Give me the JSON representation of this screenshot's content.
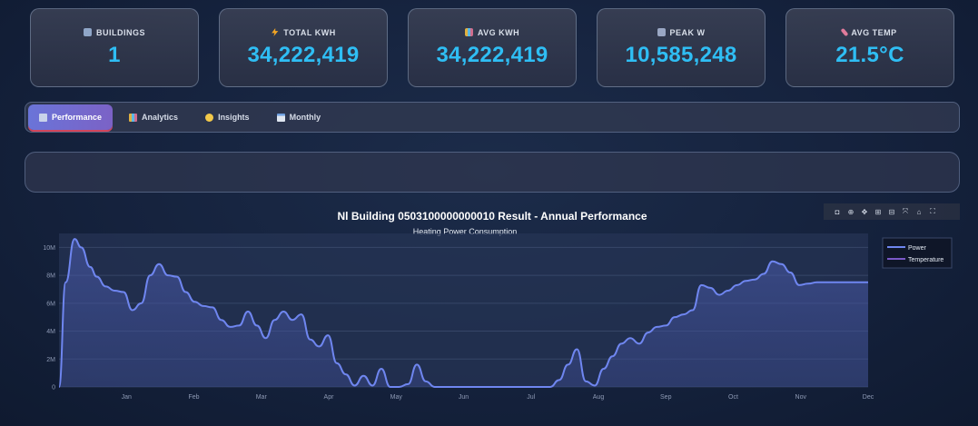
{
  "kpis": [
    {
      "label": "BUILDINGS",
      "value": "1",
      "icon": "building-icon",
      "icon_color": "#8fa6c8"
    },
    {
      "label": "TOTAL KWH",
      "value": "34,222,419",
      "icon": "lightning-icon",
      "icon_color": "#f5a623"
    },
    {
      "label": "AVG KWH",
      "value": "34,222,419",
      "icon": "bar-chart-icon",
      "icon_color": "#8c7fd4"
    },
    {
      "label": "PEAK W",
      "value": "10,585,248",
      "icon": "trend-chart-icon",
      "icon_color": "#9aa7c4"
    },
    {
      "label": "AVG TEMP",
      "value": "21.5°C",
      "icon": "thermometer-icon",
      "icon_color": "#e07b9b"
    }
  ],
  "tabs": [
    {
      "label": "Performance",
      "icon": "line-chart-icon",
      "active": true
    },
    {
      "label": "Analytics",
      "icon": "bar-chart-icon",
      "active": false
    },
    {
      "label": "Insights",
      "icon": "lightbulb-icon",
      "active": false
    },
    {
      "label": "Monthly",
      "icon": "calendar-icon",
      "active": false
    }
  ],
  "colors": {
    "accent": "#2fbef4",
    "series_power": "#6f86f0",
    "series_temperature": "#7a58c8"
  },
  "chart_data": {
    "type": "area",
    "title": "Nl Building 0503100000000010 Result - Annual Performance",
    "subtitle": "Heating Power Consumption",
    "xlabel": "",
    "ylabel": "",
    "x_tick_labels": [
      "Jan",
      "Feb",
      "Mar",
      "Apr",
      "May",
      "Jun",
      "Jul",
      "Aug",
      "Sep",
      "Oct",
      "Nov",
      "Dec"
    ],
    "y_tick_labels": [
      "0",
      "2M",
      "4M",
      "6M",
      "8M",
      "10M"
    ],
    "ylim": [
      0,
      11000000
    ],
    "x_unit": "day of year",
    "xlim": [
      1,
      365
    ],
    "grid": true,
    "legend": {
      "placement": "top-right",
      "entries": [
        "Power",
        "Temperature"
      ]
    },
    "series": [
      {
        "name": "Power",
        "x": [
          1,
          4,
          8,
          11,
          15,
          18,
          22,
          26,
          30,
          34,
          38,
          42,
          46,
          50,
          54,
          58,
          62,
          66,
          70,
          74,
          78,
          82,
          86,
          90,
          94,
          98,
          102,
          106,
          110,
          114,
          118,
          122,
          126,
          130,
          134,
          138,
          142,
          146,
          150,
          154,
          158,
          162,
          166,
          170,
          174,
          178,
          182,
          186,
          190,
          194,
          198,
          202,
          206,
          210,
          214,
          218,
          222,
          226,
          230,
          234,
          238,
          242,
          246,
          250,
          254,
          258,
          262,
          266,
          270,
          274,
          278,
          282,
          286,
          290,
          294,
          298,
          302,
          306,
          310,
          314,
          318,
          322,
          326,
          330,
          334,
          338,
          342,
          346,
          350,
          354,
          358,
          362,
          365
        ],
        "values": [
          0,
          7500000,
          10600000,
          10000000,
          8600000,
          7900000,
          7200000,
          6900000,
          6800000,
          5500000,
          6000000,
          8000000,
          8800000,
          8000000,
          7900000,
          6800000,
          6100000,
          5800000,
          5700000,
          4800000,
          4300000,
          4400000,
          5400000,
          4400000,
          3500000,
          4800000,
          5400000,
          4800000,
          5200000,
          3400000,
          2900000,
          3700000,
          1700000,
          900000,
          100000,
          800000,
          100000,
          1300000,
          0,
          0,
          200000,
          1600000,
          400000,
          0,
          0,
          0,
          0,
          0,
          0,
          0,
          0,
          0,
          0,
          0,
          0,
          0,
          0,
          500000,
          1600000,
          2700000,
          400000,
          100000,
          1300000,
          2200000,
          3100000,
          3500000,
          3100000,
          3900000,
          4300000,
          4400000,
          5000000,
          5200000,
          5500000,
          7300000,
          7100000,
          6600000,
          6900000,
          7300000,
          7600000,
          7700000,
          8100000,
          9000000,
          8800000,
          8200000,
          7300000,
          7400000,
          7500000,
          7500000,
          7500000,
          7500000,
          7500000,
          7500000,
          7500000
        ]
      },
      {
        "name": "Temperature",
        "values": []
      }
    ]
  }
}
